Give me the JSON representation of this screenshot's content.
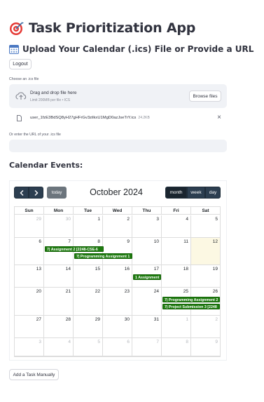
{
  "header": {
    "title": "Task Prioritization App",
    "title_icon": "target-icon",
    "subtitle": "Upload Your Calendar (.ics) File or Provide a URL",
    "subtitle_icon": "calendar-icon"
  },
  "auth": {
    "logout_label": "Logout"
  },
  "upload": {
    "label": "Choose an .ics file",
    "dropzone_title": "Drag and drop file here",
    "dropzone_sub": "Limit 200MB per file • ICS",
    "browse_label": "Browse files",
    "file_name": "user_1fzE3BdSQ8yH27gHFrGv3zilkxU1MgD0azJseTrY.ics",
    "file_size": "24.2KB"
  },
  "url": {
    "label": "Or enter the URL of your .ics file",
    "value": ""
  },
  "events_heading": "Calendar Events:",
  "calendar": {
    "title": "October 2024",
    "today_label": "today",
    "prev_label": "‹",
    "next_label": "›",
    "views": {
      "month": "month",
      "week": "week",
      "day": "day"
    },
    "days_of_week": [
      "Sun",
      "Mon",
      "Tue",
      "Wed",
      "Thu",
      "Fri",
      "Sat"
    ],
    "weeks": [
      [
        "29",
        "30",
        "1",
        "2",
        "3",
        "4",
        "5"
      ],
      [
        "6",
        "7",
        "8",
        "9",
        "10",
        "11",
        "12"
      ],
      [
        "13",
        "14",
        "15",
        "16",
        "17",
        "18",
        "19"
      ],
      [
        "20",
        "21",
        "22",
        "23",
        "24",
        "25",
        "26"
      ],
      [
        "27",
        "28",
        "29",
        "30",
        "31",
        "1",
        "2"
      ],
      [
        "3",
        "4",
        "5",
        "6",
        "7",
        "8",
        "9"
      ]
    ],
    "events": [
      "7| Assignment 2 [2248-CSE-6",
      "7| Programming Assignment 1",
      "1 Assignment",
      "7| Programming Assignment 2",
      "7| Project Submission 3 [2248"
    ],
    "colors": {
      "event": "#1e7b0f",
      "toolbar": "#2c3e50",
      "today_bg": "#fcf8e3"
    }
  },
  "actions": {
    "add_task_label": "Add a Task Manually"
  }
}
